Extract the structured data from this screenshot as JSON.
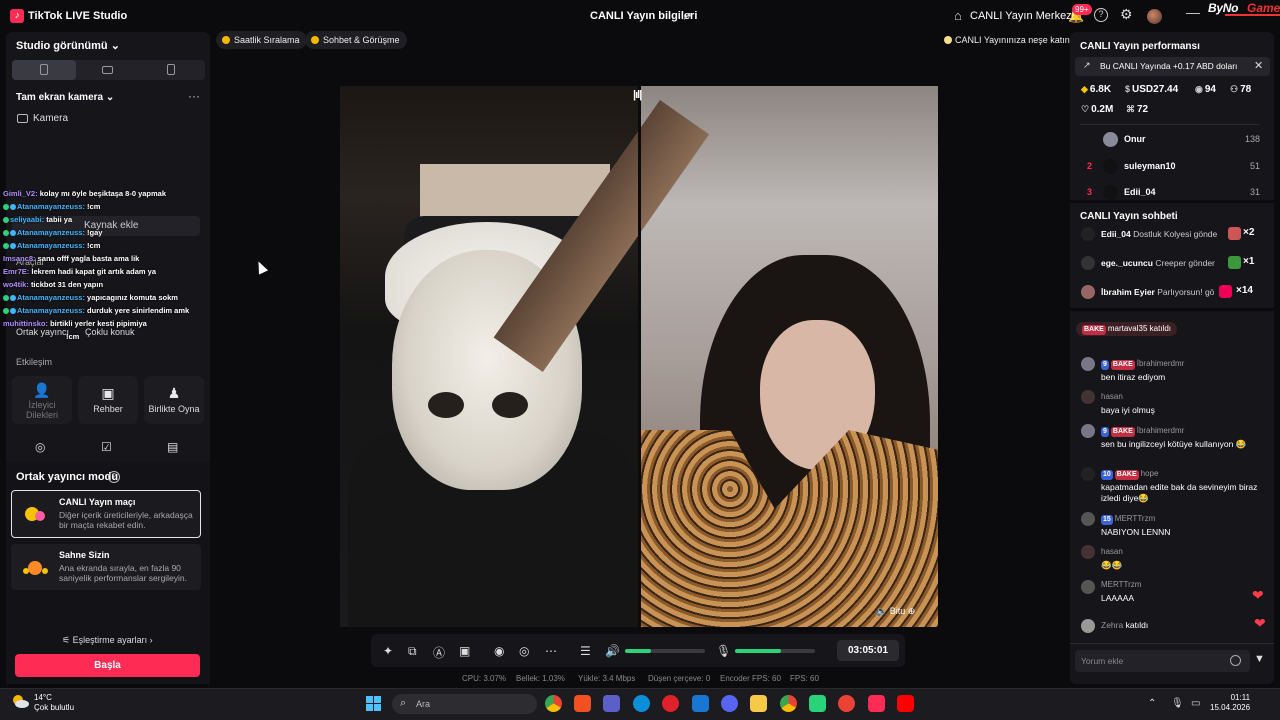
{
  "titlebar": {
    "app_name": "TikTok LIVE Studio",
    "center_title": "CANLI Yayın bilgileri",
    "live_center": "CANLI Yayın Merkezi",
    "notif_badge": "99+",
    "watermark_a": "ByNo",
    "watermark_b": "Game"
  },
  "left_panel": {
    "studio_view": "Studio görünümü",
    "fullscreen_camera": "Tam ekran kamera",
    "camera": "Kamera",
    "add_source": "Kaynak ekle",
    "tools": "Araçlar",
    "tool_labels": [
      "Ortak yayıncı",
      "Çoklu konuk"
    ],
    "interaction": "Etkileşim",
    "tiles": [
      {
        "label": "İzleyici Dilekleri",
        "icon": "viewer-request-icon"
      },
      {
        "label": "Rehber",
        "icon": "guide-icon"
      },
      {
        "label": "Birlikte Oyna",
        "icon": "play-together-icon"
      }
    ],
    "cohost_mode": "Ortak yayıncı modu",
    "cards": [
      {
        "title": "CANLI Yayın maçı",
        "desc": "Diğer içerik üreticileriyle, arkadaşça bir maçta rekabet edin."
      },
      {
        "title": "Sahne Sizin",
        "desc": "Ana ekranda sırayla, en fazla 90 saniyelik performanslar sergileyin."
      }
    ],
    "matching_settings": "Eşleştirme ayarları",
    "start": "Başla"
  },
  "overlay_chat": [
    {
      "user": "Gimli_V2:",
      "text": "kolay mı öyle beşiktaşa 8-0 yapmak"
    },
    {
      "user": "Atanamayanzeuss:",
      "text": "!cm"
    },
    {
      "user": "seliyaabi:",
      "text": "tabii ya"
    },
    {
      "user": "Atanamayanzeuss:",
      "text": "!gay"
    },
    {
      "user": "Atanamayanzeuss:",
      "text": "!cm"
    },
    {
      "user": "Imsanc8:",
      "text": "sana offf yagla basta ama lik"
    },
    {
      "user": "Emr7E:",
      "text": "lekrem hadi kapat git artık adam ya"
    },
    {
      "user": "wo4tik:",
      "text": "tickbot 31 den yapın"
    },
    {
      "user": "Atanamayanzeuss:",
      "text": "yapıcagınız komuta sokm"
    },
    {
      "user": "Atanamayanzeuss:",
      "text": "durduk yere sinirlendim amk"
    },
    {
      "user": "muhittinsko:",
      "text": "birtikli yerler kesti pipimiya"
    },
    {
      "user": "",
      "text": "!cm"
    }
  ],
  "top_chips": [
    "Saatlik Sıralama",
    "Sohbet & Görüşme"
  ],
  "add_fun": "CANLI Yayınınıza neşe katın",
  "video": {
    "guest_name": "Bitu"
  },
  "controls": {
    "timer": "03:05:01",
    "music_level": 0.33,
    "mic_level": 0.58
  },
  "stats": {
    "cpu": "CPU: 3.07%",
    "memory": "Bellek: 1.03%",
    "upload": "Yükle: 3.4 Mbps",
    "dropped": "Düşen çerçeve: 0",
    "encoder_fps": "Encoder FPS: 60",
    "fps": "FPS: 60"
  },
  "right_panel": {
    "performance_title": "CANLI Yayın performansı",
    "earnings_notice": "Bu CANLI Yayında +0.17 ABD doları",
    "stats": {
      "diamonds": "6.8K",
      "usd": "USD27.44",
      "viewers": "94",
      "new_followers": "78",
      "likes": "0.2M",
      "gifters": "72"
    },
    "ranking": [
      {
        "rank": "",
        "user": "Onur",
        "value": "138"
      },
      {
        "rank": "2",
        "user": "suleyman10",
        "value": "51"
      },
      {
        "rank": "3",
        "user": "Edii_04",
        "value": "31"
      }
    ],
    "chat_title": "CANLI Yayın sohbeti",
    "gifts": [
      {
        "user": "Edii_04",
        "text": "Dostluk Kolyesi gönde",
        "count": "×2"
      },
      {
        "user": "ege._ucuncu",
        "text": "Creeper gönder",
        "count": "×1"
      },
      {
        "user": "İbrahim Eyier",
        "text": "Parlıyorsun! gö",
        "count": "×14"
      }
    ],
    "join_notice": "martaval35 katıldı",
    "comments": [
      {
        "level": "9",
        "badge": "BAKE",
        "user": "İbrahimerdmr",
        "text": "ben itiraz ediyom"
      },
      {
        "level": "",
        "badge": "",
        "user": "hasan",
        "text": "baya iyi olmuş"
      },
      {
        "level": "9",
        "badge": "BAKE",
        "user": "İbrahimerdmr",
        "text": "sen bu ingilizceyi kötüye kullanıyon 😂"
      },
      {
        "level": "10",
        "badge": "BAKE",
        "user": "hope",
        "text": "kapatmadan edite bak da sevineyim biraz izledi diye😂"
      },
      {
        "level": "15",
        "badge": "",
        "user": "MERTTrzm",
        "text": "NABIYON LENNN"
      },
      {
        "level": "",
        "badge": "",
        "user": "hasan",
        "text": "😂😂"
      },
      {
        "level": "",
        "badge": "",
        "user": "MERTTrzm",
        "text": "LAAAAA"
      }
    ],
    "last_join_user": "Zehra",
    "last_join_text": "katıldı",
    "comment_placeholder": "Yorum ekle"
  },
  "taskbar": {
    "temp": "14°C",
    "weather": "Çok bulutlu",
    "search": "Ara",
    "time": "01:11",
    "date": "15.04.2026"
  }
}
